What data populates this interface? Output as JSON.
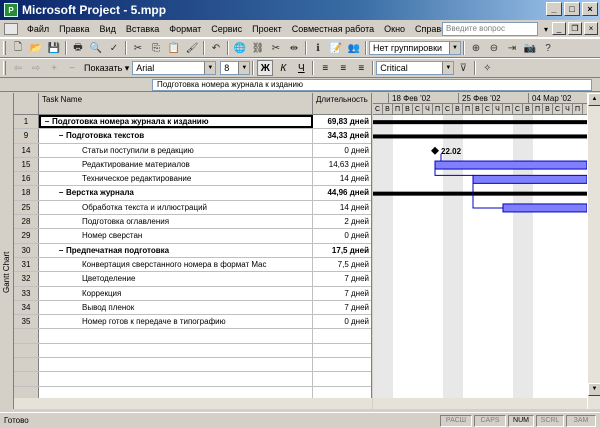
{
  "window": {
    "title": "Microsoft Project - 5.mpp"
  },
  "menu": {
    "items": [
      "Файл",
      "Правка",
      "Вид",
      "Вставка",
      "Формат",
      "Сервис",
      "Проект",
      "Совместная работа",
      "Окно",
      "Справка"
    ],
    "help_placeholder": "Введите вопрос"
  },
  "toolbar": {
    "group_value": "Нет группировки",
    "show_label": "Показать",
    "font_value": "Arial",
    "size_value": "8",
    "filter_value": "Critical",
    "bold_label": "Ж",
    "italic_label": "К",
    "underline_label": "Ч"
  },
  "entry_bar": {
    "value": "Подготовка номера журнала к изданию"
  },
  "view_bar": {
    "label": "Gantt Chart"
  },
  "table": {
    "col_name": "Task Name",
    "col_duration": "Длительность",
    "rows": [
      {
        "id": "1",
        "name": "Подготовка номера журнала к изданию",
        "duration": "69,83 дней",
        "level": 0,
        "summary": true
      },
      {
        "id": "9",
        "name": "Подготовка текстов",
        "duration": "34,33 дней",
        "level": 1,
        "summary": true
      },
      {
        "id": "14",
        "name": "Статьи поступили в редакцию",
        "duration": "0 дней",
        "level": 2,
        "summary": false
      },
      {
        "id": "15",
        "name": "Редактирование материалов",
        "duration": "14,63 дней",
        "level": 2,
        "summary": false
      },
      {
        "id": "16",
        "name": "Техническое редактирование",
        "duration": "14 дней",
        "level": 2,
        "summary": false
      },
      {
        "id": "18",
        "name": "Верстка журнала",
        "duration": "44,96 дней",
        "level": 1,
        "summary": true
      },
      {
        "id": "25",
        "name": "Обработка текста и иллюстраций",
        "duration": "14 дней",
        "level": 2,
        "summary": false
      },
      {
        "id": "28",
        "name": "Подготовка оглавления",
        "duration": "2 дней",
        "level": 2,
        "summary": false
      },
      {
        "id": "29",
        "name": "Номер сверстан",
        "duration": "0 дней",
        "level": 2,
        "summary": false
      },
      {
        "id": "30",
        "name": "Предпечатная подготовка",
        "duration": "17,5 дней",
        "level": 1,
        "summary": true
      },
      {
        "id": "31",
        "name": "Конвертация сверстанного номера в формат Mac",
        "duration": "7,5 дней",
        "level": 2,
        "summary": false
      },
      {
        "id": "32",
        "name": "Цветоделение",
        "duration": "7 дней",
        "level": 2,
        "summary": false
      },
      {
        "id": "33",
        "name": "Коррекция",
        "duration": "7 дней",
        "level": 2,
        "summary": false
      },
      {
        "id": "34",
        "name": "Вывод пленок",
        "duration": "7 дней",
        "level": 2,
        "summary": false
      },
      {
        "id": "35",
        "name": "Номер готов к передаче в типографию",
        "duration": "0 дней",
        "level": 2,
        "summary": false
      }
    ]
  },
  "gantt": {
    "weeks": [
      "18 Фев '02",
      "25 Фев '02",
      "04 Мар '02"
    ],
    "days": [
      "С",
      "В",
      "П",
      "В",
      "С",
      "Ч",
      "П",
      "С",
      "В",
      "П",
      "В",
      "С",
      "Ч",
      "П",
      "С",
      "В",
      "П",
      "В",
      "С",
      "Ч",
      "П"
    ],
    "milestone_label": "22.02"
  },
  "status": {
    "text": "Готово",
    "indicators": [
      "РАСШ",
      "CAPS",
      "NUM",
      "SCRL",
      "ЗАМ"
    ]
  },
  "colors": {
    "bar": "#8080ff",
    "summary": "#000000",
    "titlebar": "#0a246a"
  }
}
